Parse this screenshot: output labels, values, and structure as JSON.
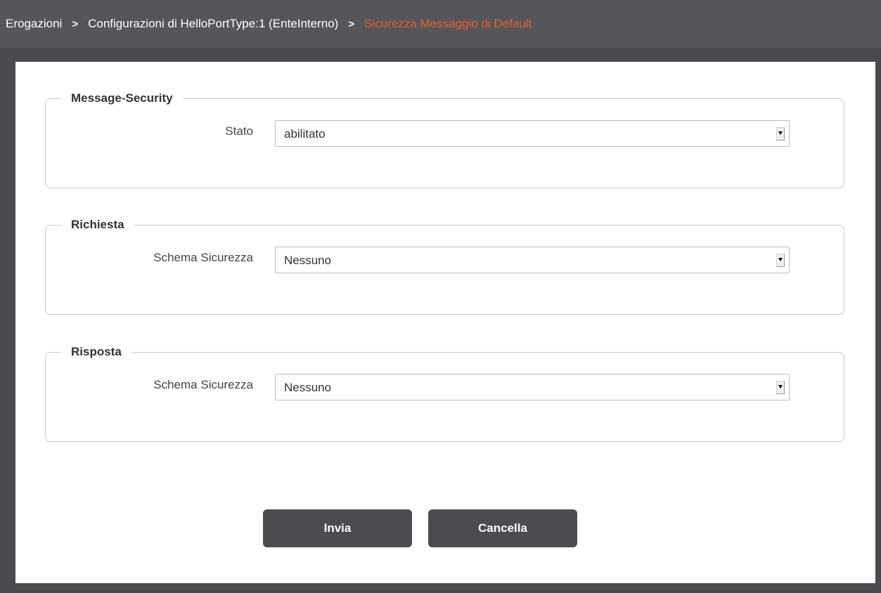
{
  "breadcrumb": {
    "item1": "Erogazioni",
    "item2": "Configurazioni di HelloPortType:1 (EnteInterno)",
    "current": "Sicurezza Messaggio di Default",
    "separator": ">"
  },
  "sections": {
    "message_security": {
      "legend": "Message-Security",
      "field_label": "Stato",
      "selected_value": "abilitato"
    },
    "richiesta": {
      "legend": "Richiesta",
      "field_label": "Schema Sicurezza",
      "selected_value": "Nessuno"
    },
    "risposta": {
      "legend": "Risposta",
      "field_label": "Schema Sicurezza",
      "selected_value": "Nessuno"
    }
  },
  "buttons": {
    "submit_label": "Invia",
    "cancel_label": "Cancella"
  },
  "colors": {
    "header_bg": "#55555a",
    "accent_current": "#e8602c",
    "button_bg": "#4b4b50"
  }
}
